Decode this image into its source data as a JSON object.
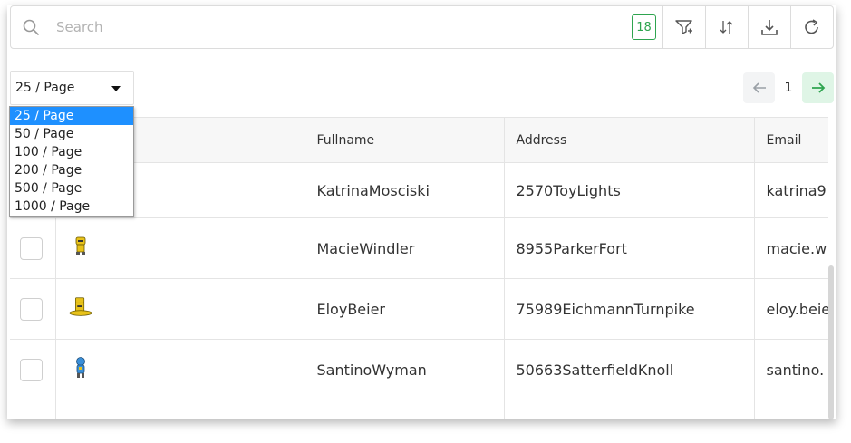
{
  "search": {
    "placeholder": "Search",
    "value": "",
    "result_count": "18"
  },
  "toolbar": {
    "filter_icon": "filter-icon",
    "sort_icon": "sort-icon",
    "download_icon": "download-icon",
    "refresh_icon": "refresh-icon"
  },
  "page_size": {
    "selected": "25 / Page",
    "options": [
      "25 / Page",
      "50 / Page",
      "100 / Page",
      "200 / Page",
      "500 / Page",
      "1000 / Page"
    ]
  },
  "pagination": {
    "current_page": "1"
  },
  "table": {
    "columns": [
      "",
      "",
      "Fullname",
      "Address",
      "Email"
    ],
    "rows": [
      {
        "fullname": "KatrinaMosciski",
        "address": "2570ToyLights",
        "email": "katrina9",
        "avatar": "robot-avatar-hidden"
      },
      {
        "fullname": "MacieWindler",
        "address": "8955ParkerFort",
        "email": "macie.w",
        "avatar": "robot-avatar-yellow"
      },
      {
        "fullname": "EloyBeier",
        "address": "75989EichmannTurnpike",
        "email": "eloy.beie",
        "avatar": "robot-avatar-yellow-wide"
      },
      {
        "fullname": "SantinoWyman",
        "address": "50663SatterfieldKnoll",
        "email": "santino.",
        "avatar": "robot-avatar-blue"
      },
      {
        "fullname": "",
        "address": "",
        "email": "",
        "avatar": ""
      }
    ]
  },
  "colors": {
    "accent_green": "#2ea44f",
    "selected_option": "#1e90ff"
  }
}
